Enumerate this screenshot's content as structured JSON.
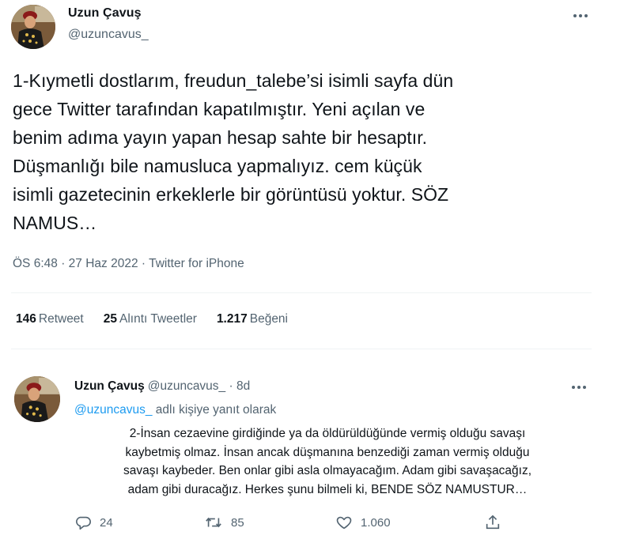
{
  "main_tweet": {
    "author_name": "Uzun Çavuş",
    "handle": "@uzuncavus_",
    "text": "1-Kıymetli dostlarım, freudun_talebe’si isimli sayfa dün\ngece Twitter tarafından kapatılmıştır. Yeni açılan ve\nbenim adıma yayın yapan hesap sahte bir hesaptır.\nDüşmanlığı bile namusluca yapmalıyız.  cem küçük\nisimli gazetecinin erkeklerle bir görüntüsü yoktur. SÖZ\nNAMUS…",
    "time": "ÖS 6:48",
    "date": "27 Haz 2022",
    "separator": "·",
    "source": "Twitter for iPhone",
    "more_icon": "ellipsis-icon"
  },
  "stats": {
    "retweets": {
      "count": "146",
      "label": "Retweet"
    },
    "quotes": {
      "count": "25",
      "label": "Alıntı Tweetler"
    },
    "likes": {
      "count": "1.217",
      "label": "Beğeni"
    }
  },
  "reply": {
    "author_name": "Uzun Çavuş",
    "handle": "@uzuncavus_",
    "separator": "·",
    "time_ago": "8d",
    "replying_mention": "@uzuncavus_",
    "replying_suffix": " adlı kişiye yanıt olarak",
    "text_lines": [
      "2-İnsan cezaevine girdiğinde ya da öldürüldüğünde vermiş olduğu savaşı",
      "kaybetmiş olmaz. İnsan ancak düşmanına benzediği zaman vermiş olduğu",
      "savaşı kaybeder. Ben onlar gibi asla olmayacağım. Adam gibi savaşacağız,",
      "adam gibi duracağız. Herkes şunu bilmeli ki, BENDE SÖZ NAMUSTUR…"
    ],
    "actions": {
      "reply_count": "24",
      "retweet_count": "85",
      "like_count": "1.060"
    },
    "icons": [
      "reply-icon",
      "retweet-icon",
      "heart-icon",
      "share-icon"
    ]
  },
  "colors": {
    "accent": "#1d9bf0",
    "text_primary": "#0f1419",
    "text_secondary": "#536471",
    "divider": "#eff3f4"
  }
}
